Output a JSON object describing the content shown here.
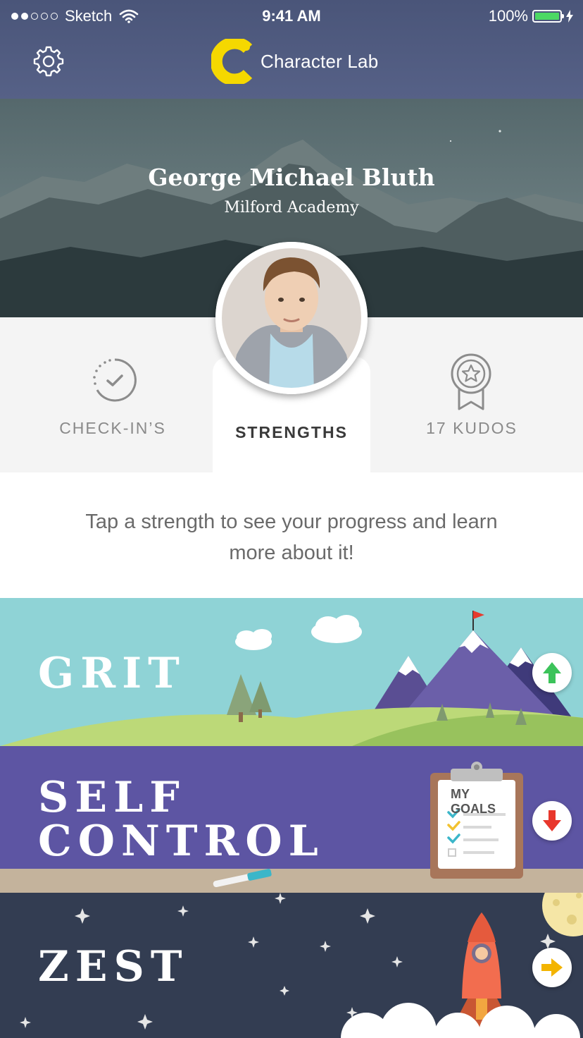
{
  "status_bar": {
    "carrier": "Sketch",
    "time": "9:41 AM",
    "battery": "100%"
  },
  "nav": {
    "brand_name": "Character Lab",
    "brand_color": "#f5d800"
  },
  "profile": {
    "name": "George Michael Bluth",
    "school": "Milford Academy"
  },
  "tabs": {
    "checkins_label": "CHECK-IN’S",
    "strengths_label": "STRENGTHS",
    "kudos_label": "17 KUDOS",
    "selected": "STRENGTHS"
  },
  "intro": {
    "text": "Tap a strength to see your progress and learn more about it!"
  },
  "strengths": [
    {
      "title": "GRIT",
      "trend": "up",
      "trend_color": "#3cc35a",
      "bg": "#8fd3d6"
    },
    {
      "title": "SELF CONTROL",
      "line1": "SELF",
      "line2": "CONTROL",
      "trend": "down",
      "trend_color": "#e8372c",
      "bg": "#5d55a3",
      "clipboard_text": "MY GOALS"
    },
    {
      "title": "ZEST",
      "trend": "right",
      "trend_color": "#f3b400",
      "bg": "#333d52"
    }
  ],
  "icons": {
    "settings": "gear-icon",
    "checkins": "check-circle-icon",
    "kudos": "award-ribbon-icon"
  }
}
